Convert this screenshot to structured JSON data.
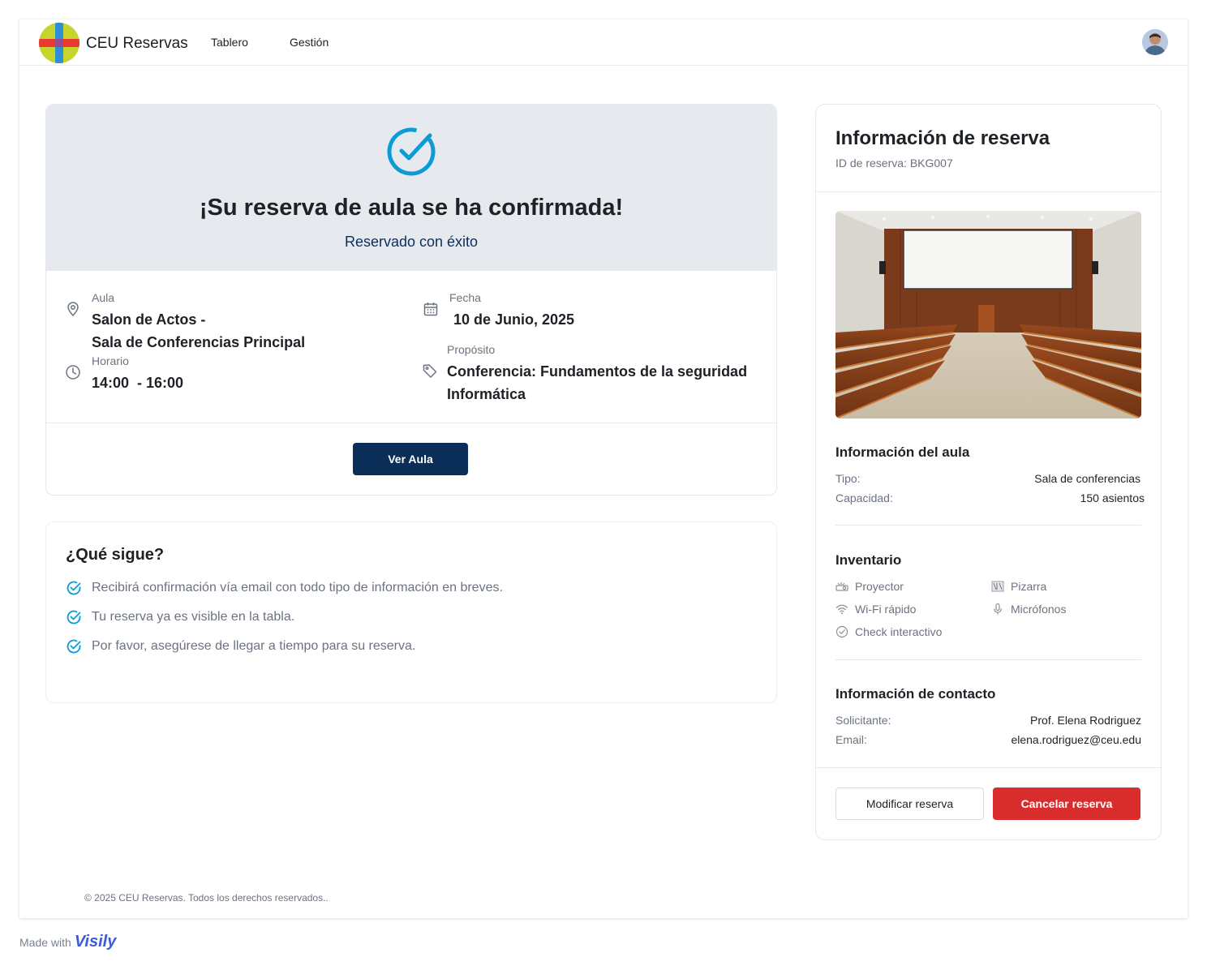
{
  "app": {
    "name": "CEU Reservas"
  },
  "nav": {
    "items": [
      {
        "label": "Tablero"
      },
      {
        "label": "Gestión"
      }
    ]
  },
  "confirmation": {
    "title": "¡Su reserva de aula se ha confirmada!",
    "subtitle": "Reservado con éxito",
    "aula_label": "Aula",
    "aula_line1": "Salon de Actos -",
    "aula_line2": "Sala de Conferencias Principal",
    "horario_label": "Horario",
    "horario_value": "14:00  - 16:00",
    "fecha_label": "Fecha",
    "fecha_value": "10 de Junio, 2025",
    "proposito_label": "Propósito",
    "proposito_line1": "Conferencia: Fundamentos de la seguridad",
    "proposito_line2": "Informática",
    "view_button": "Ver Aula"
  },
  "next_steps": {
    "title": "¿Qué sigue?",
    "items": [
      "Recibirá confirmación vía email con todo tipo de información en breves.",
      "Tu reserva ya es visible en la tabla.",
      "Por favor, asegúrese de llegar a tiempo para su reserva."
    ]
  },
  "booking_info": {
    "title": "Información de reserva",
    "id_text": "ID de reserva: BKG007",
    "room_section": {
      "title": "Información del aula",
      "rows": [
        {
          "key": "Tipo:",
          "value": "Sala de conferencias"
        },
        {
          "key": "Capacidad:",
          "value": "150 asientos"
        }
      ]
    },
    "inventory": {
      "title": "Inventario",
      "items": [
        {
          "label": "Proyector",
          "icon": "projector-icon"
        },
        {
          "label": "Pizarra",
          "icon": "whiteboard-icon"
        },
        {
          "label": "Wi-Fi rápido",
          "icon": "wifi-icon"
        },
        {
          "label": "Micrófonos",
          "icon": "microphone-icon"
        },
        {
          "label": "Check interactivo",
          "icon": "check-circle-icon"
        }
      ]
    },
    "contact": {
      "title": "Información de contacto",
      "rows": [
        {
          "key": "Solicitante:",
          "value": "Prof. Elena Rodriguez"
        },
        {
          "key": "Email:",
          "value": "elena.rodriguez@ceu.edu"
        }
      ]
    },
    "modify_button": "Modificar reserva",
    "cancel_button": "Cancelar reserva"
  },
  "footer": {
    "copyright": "© 2025 CEU Reservas. Todos los derechos reservados.."
  },
  "badge": {
    "made_with": "Made with",
    "brand": "Visily"
  },
  "colors": {
    "primary": "#0b2e59",
    "accent": "#0d9bd7",
    "danger": "#d92d2d",
    "confirm_bg": "#e6eaee"
  }
}
